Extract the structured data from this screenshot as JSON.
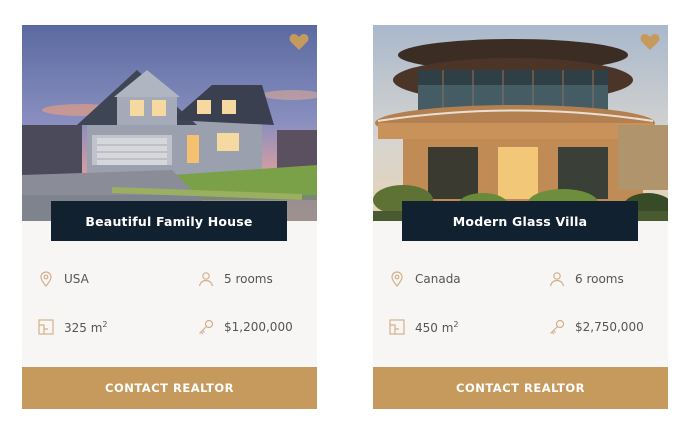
{
  "listings": [
    {
      "title": "Beautiful Family House",
      "location": "USA",
      "rooms": "5 rooms",
      "area_value": "325 m",
      "area_sup": "2",
      "price": "$1,200,000",
      "cta": "CONTACT REALTOR"
    },
    {
      "title": "Modern Glass Villa",
      "location": "Canada",
      "rooms": "6 rooms",
      "area_value": "450 m",
      "area_sup": "2",
      "price": "$2,750,000",
      "cta": "CONTACT REALTOR"
    }
  ],
  "icons": {
    "favorite": "heart-icon",
    "location": "map-pin-icon",
    "rooms": "user-icon",
    "area": "floor-plan-icon",
    "price": "key-icon"
  },
  "colors": {
    "accent": "#c69a5d",
    "title_bar": "#11212f",
    "card_bg": "#f7f6f4",
    "icon": "#d4b08a"
  }
}
